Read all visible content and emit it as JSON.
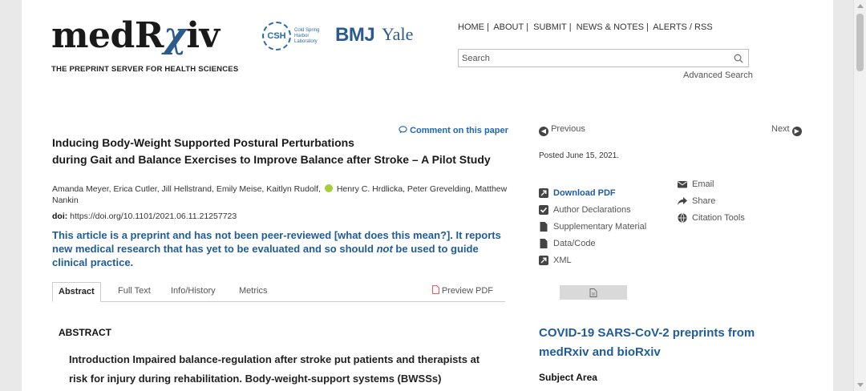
{
  "header": {
    "logo_main": "medR",
    "logo_accent": "χ",
    "logo_end": "iv",
    "tagline": "THE PREPRINT SERVER FOR HEALTH SCIENCES",
    "partners": {
      "csh_mark": "CSH",
      "csh_text": "Cold Spring Harbor Laboratory",
      "bmj": "BMJ",
      "yale": "Yale"
    },
    "nav": [
      "HOME",
      "ABOUT",
      "SUBMIT",
      "NEWS & NOTES",
      "ALERTS / RSS"
    ],
    "search_placeholder": "Search",
    "advanced_search": "Advanced Search"
  },
  "article": {
    "comment_link": "Comment on this paper",
    "title_line1": "Inducing Body-Weight Supported Postural Perturbations",
    "title_line2": "during Gait and Balance Exercises to Improve Balance after Stroke – A Pilot Study",
    "authors_part1": "Amanda Meyer, Erica Cutler, Jill Hellstrand, Emily Meise, Kaitlyn Rudolf,",
    "authors_part2": "Henry C. Hrdlicka, Peter Grevelding, Matthew Nankin",
    "doi_label": "doi:",
    "doi_value": "https://doi.org/10.1101/2021.06.11.21257723",
    "note_part1": "This article is a preprint and has not been peer-reviewed [what does this mean?]. It reports new medical research that has yet to be evaluated and so should ",
    "note_em": "not",
    "note_part2": " be used to guide clinical practice.",
    "tabs": [
      "Abstract",
      "Full Text",
      "Info/History",
      "Metrics"
    ],
    "preview_pdf": "Preview PDF",
    "abstract_heading": "ABSTRACT",
    "abstract_text": "Introduction Impaired balance-regulation after stroke put patients and therapists at risk for injury during rehabilitation. Body-weight-support systems (BWSSs)"
  },
  "sidebar": {
    "previous": "Previous",
    "next": "Next",
    "posted": "Posted June 15, 2021.",
    "actions_left": [
      "Download PDF",
      "Author Declarations",
      "Supplementary Material",
      "Data/Code",
      "XML"
    ],
    "actions_right": [
      "Email",
      "Share",
      "Citation Tools"
    ],
    "covid_title": "COVID-19 SARS-CoV-2 preprints from medRxiv and bioRxiv",
    "subject_area": "Subject Area"
  }
}
